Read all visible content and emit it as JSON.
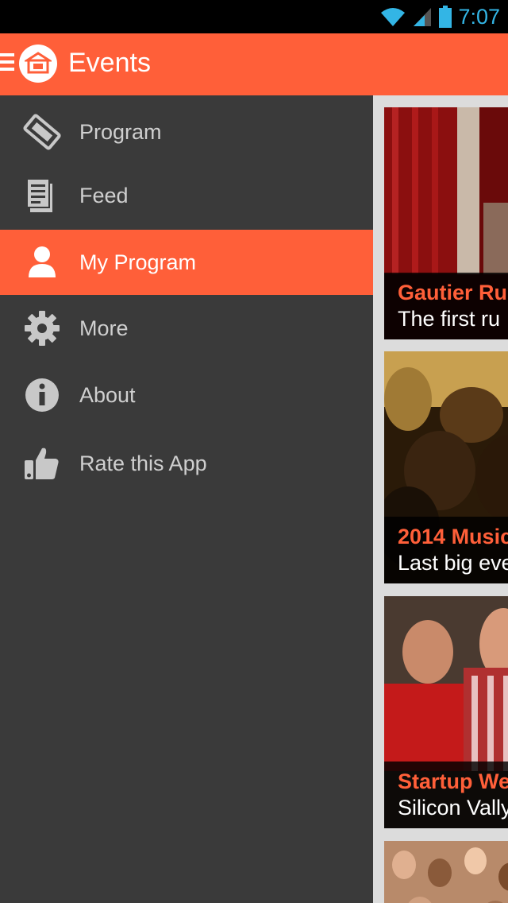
{
  "status_bar": {
    "time": "7:07",
    "icons": [
      "wifi-icon",
      "signal-icon",
      "battery-icon"
    ]
  },
  "action_bar": {
    "title": "Events",
    "logo_icon": "stage-icon",
    "toggle_icon": "menu-icon"
  },
  "drawer": {
    "items": [
      {
        "label": "Program",
        "icon": "ticket-icon",
        "active": false
      },
      {
        "label": "Feed",
        "icon": "newspaper-icon",
        "active": false
      },
      {
        "label": "My Program",
        "icon": "person-icon",
        "active": true
      },
      {
        "label": "More",
        "icon": "gear-icon",
        "active": false
      },
      {
        "label": "About",
        "icon": "info-icon",
        "active": false
      },
      {
        "label": "Rate this App",
        "icon": "thumbs-up-icon",
        "active": false
      }
    ]
  },
  "events": [
    {
      "title": "Gautier Ru",
      "subtitle": "The first ru"
    },
    {
      "title": "2014 Music",
      "subtitle": "Last big eve"
    },
    {
      "title": "Startup We",
      "subtitle": "Silicon Vally"
    }
  ],
  "colors": {
    "accent": "#ff5f39",
    "drawer_bg": "#3a3a3a",
    "status_time": "#33b5e5"
  }
}
